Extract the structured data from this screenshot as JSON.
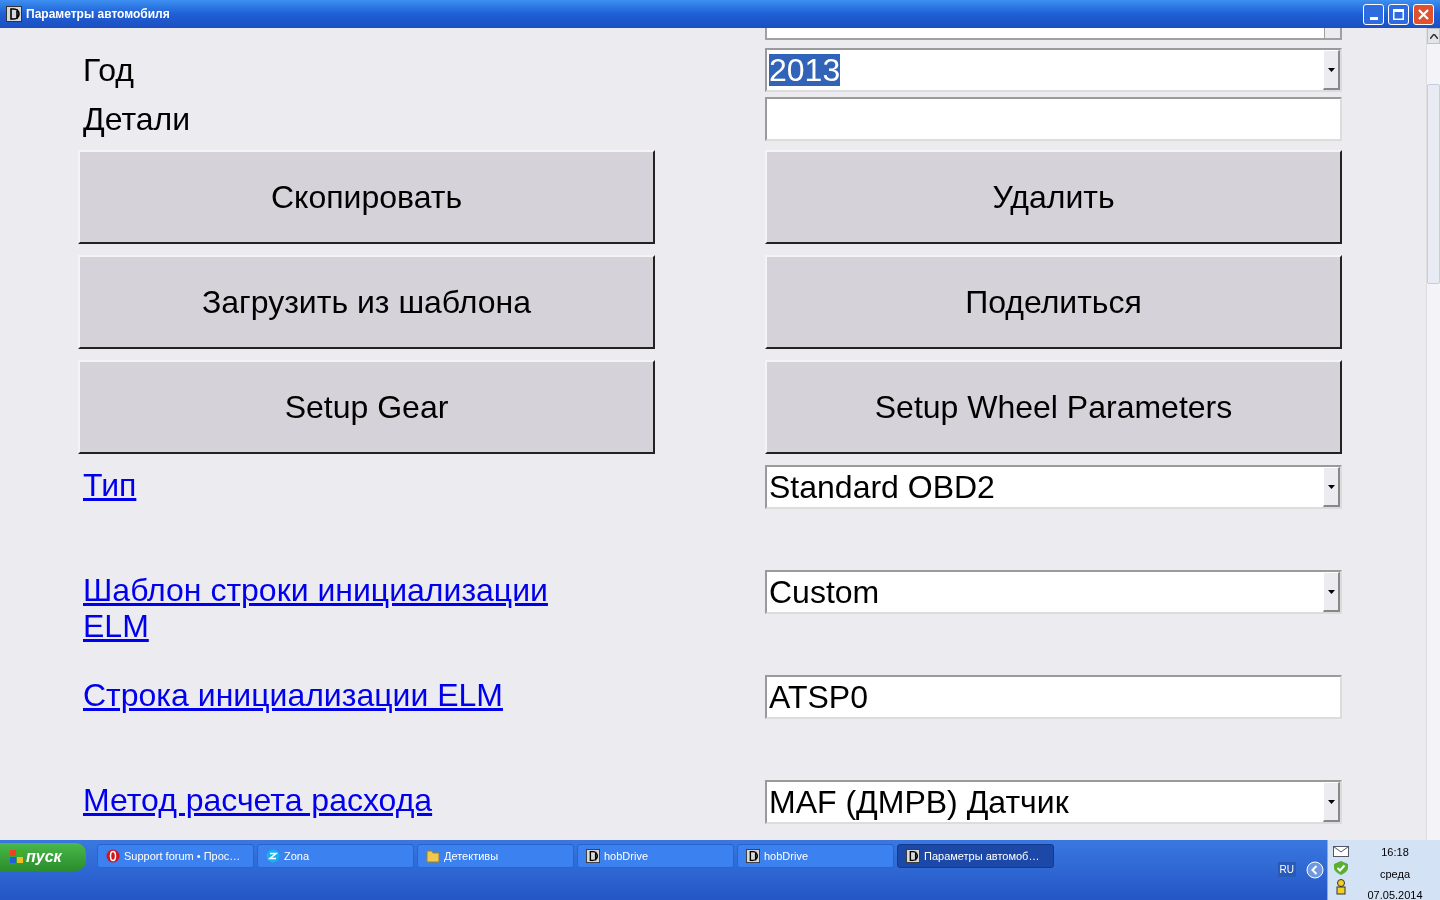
{
  "window": {
    "title": "Параметры автомобиля"
  },
  "rows": [
    {
      "kind": "field",
      "label": "Год",
      "field": {
        "kind": "combo",
        "value": "2013",
        "text_selected": true
      }
    },
    {
      "kind": "field",
      "label": "Детали",
      "field": {
        "kind": "text",
        "text_selected": false
      }
    },
    {
      "kind": "buttons",
      "buttons": [
        "Скопировать",
        "Удалить"
      ]
    },
    {
      "kind": "buttons",
      "buttons": [
        "Загрузить из шаблона",
        "Поделиться"
      ]
    },
    {
      "kind": "buttons",
      "buttons": [
        "Setup Gear",
        "Setup Wheel Parameters"
      ]
    },
    {
      "kind": "link",
      "label": "Тип",
      "field": {
        "kind": "combo",
        "value": "Standard OBD2",
        "text_selected": false
      }
    },
    {
      "kind": "link",
      "label": "Шаблон строки инициализации ELM",
      "field": {
        "kind": "combo",
        "value": "Custom",
        "text_selected": false
      }
    },
    {
      "kind": "link",
      "label": "Строка инициализации ELM",
      "field": {
        "kind": "text",
        "value": "ATSP0",
        "text_selected": false
      }
    },
    {
      "kind": "link",
      "label": "Метод расчета расхода",
      "field": {
        "kind": "combo",
        "value": "MAF (ДМРВ) Датчик",
        "text_selected": false
      }
    }
  ],
  "taskbar": {
    "start": "пуск",
    "tasks": [
      {
        "kind": "browser",
        "label": "Support forum • Прос…",
        "selected": false
      },
      {
        "kind": "player",
        "label": "Zona",
        "selected": false
      },
      {
        "kind": "folder",
        "label": "Детективы",
        "selected": false
      },
      {
        "kind": "app",
        "label": "hobDrive",
        "selected": false
      },
      {
        "kind": "app",
        "label": "hobDrive",
        "selected": false
      },
      {
        "kind": "app",
        "label": "Параметры автомоб…",
        "selected": true
      }
    ],
    "language": "RU",
    "time": "16:18",
    "day": "среда",
    "date": "07.05.2014"
  }
}
